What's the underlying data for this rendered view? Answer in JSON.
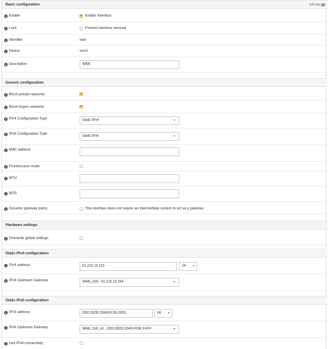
{
  "full_help": "full help",
  "sections": {
    "basic": "Basic configuration",
    "generic": "Generic configuration",
    "hardware": "Hardware settings",
    "ipv4": "Static IPv4 configuration",
    "ipv6": "Static IPv6 configuration"
  },
  "basic": {
    "enable_label": "Enable",
    "enable_text": "Enable Interface",
    "enable_checked": true,
    "lock_label": "Lock",
    "lock_text": "Prevent interface removal",
    "lock_checked": false,
    "identifier_label": "Identifier",
    "identifier_value": "wan",
    "device_label": "Device",
    "device_value": "vmx1",
    "description_label": "Description",
    "description_value": "WAN"
  },
  "generic": {
    "block_private_label": "Block private networks",
    "block_private_checked": true,
    "block_bogon_label": "Block bogon networks",
    "block_bogon_checked": true,
    "ipv4_type_label": "IPv4 Configuration Type",
    "ipv4_type_value": "Static IPv4",
    "ipv6_type_label": "IPv6 Configuration Type",
    "ipv6_type_value": "Static IPv6",
    "mac_label": "MAC address",
    "mac_value": "",
    "promisc_label": "Promiscuous mode",
    "mtu_label": "MTU",
    "mtu_value": "",
    "mss_label": "MSS",
    "mss_value": "",
    "dyn_gw_label": "Dynamic gateway policy",
    "dyn_gw_text": "This interface does not require an intermediate system to act as a gateway"
  },
  "hardware": {
    "overwrite_label": "Overwrite global settings"
  },
  "ipv4": {
    "address_label": "IPv4 address",
    "address_value": "61.216.14.215",
    "prefix_value": "24",
    "gateway_label": "IPv4 Upstream Gateway",
    "gateway_value": "WAN_GW - 61.216.14.254"
  },
  "ipv6": {
    "address_label": "IPv6 address",
    "address_value": "2001:B030:2049:FF99::0001",
    "prefix_value": "64",
    "gateway_label": "IPv6 Upstream Gateway",
    "gateway_value": "WAN_GW_v6 - 2001:B030:2049:FF99::FFFF",
    "use_ipv4_label": "Use IPv4 connectivity"
  },
  "colors": {
    "checkbox_checked": "#e8a631",
    "section_bg": "#f5f5f5"
  },
  "icons": {
    "info": "info-circle-icon",
    "full_help": "toggle-icon"
  }
}
